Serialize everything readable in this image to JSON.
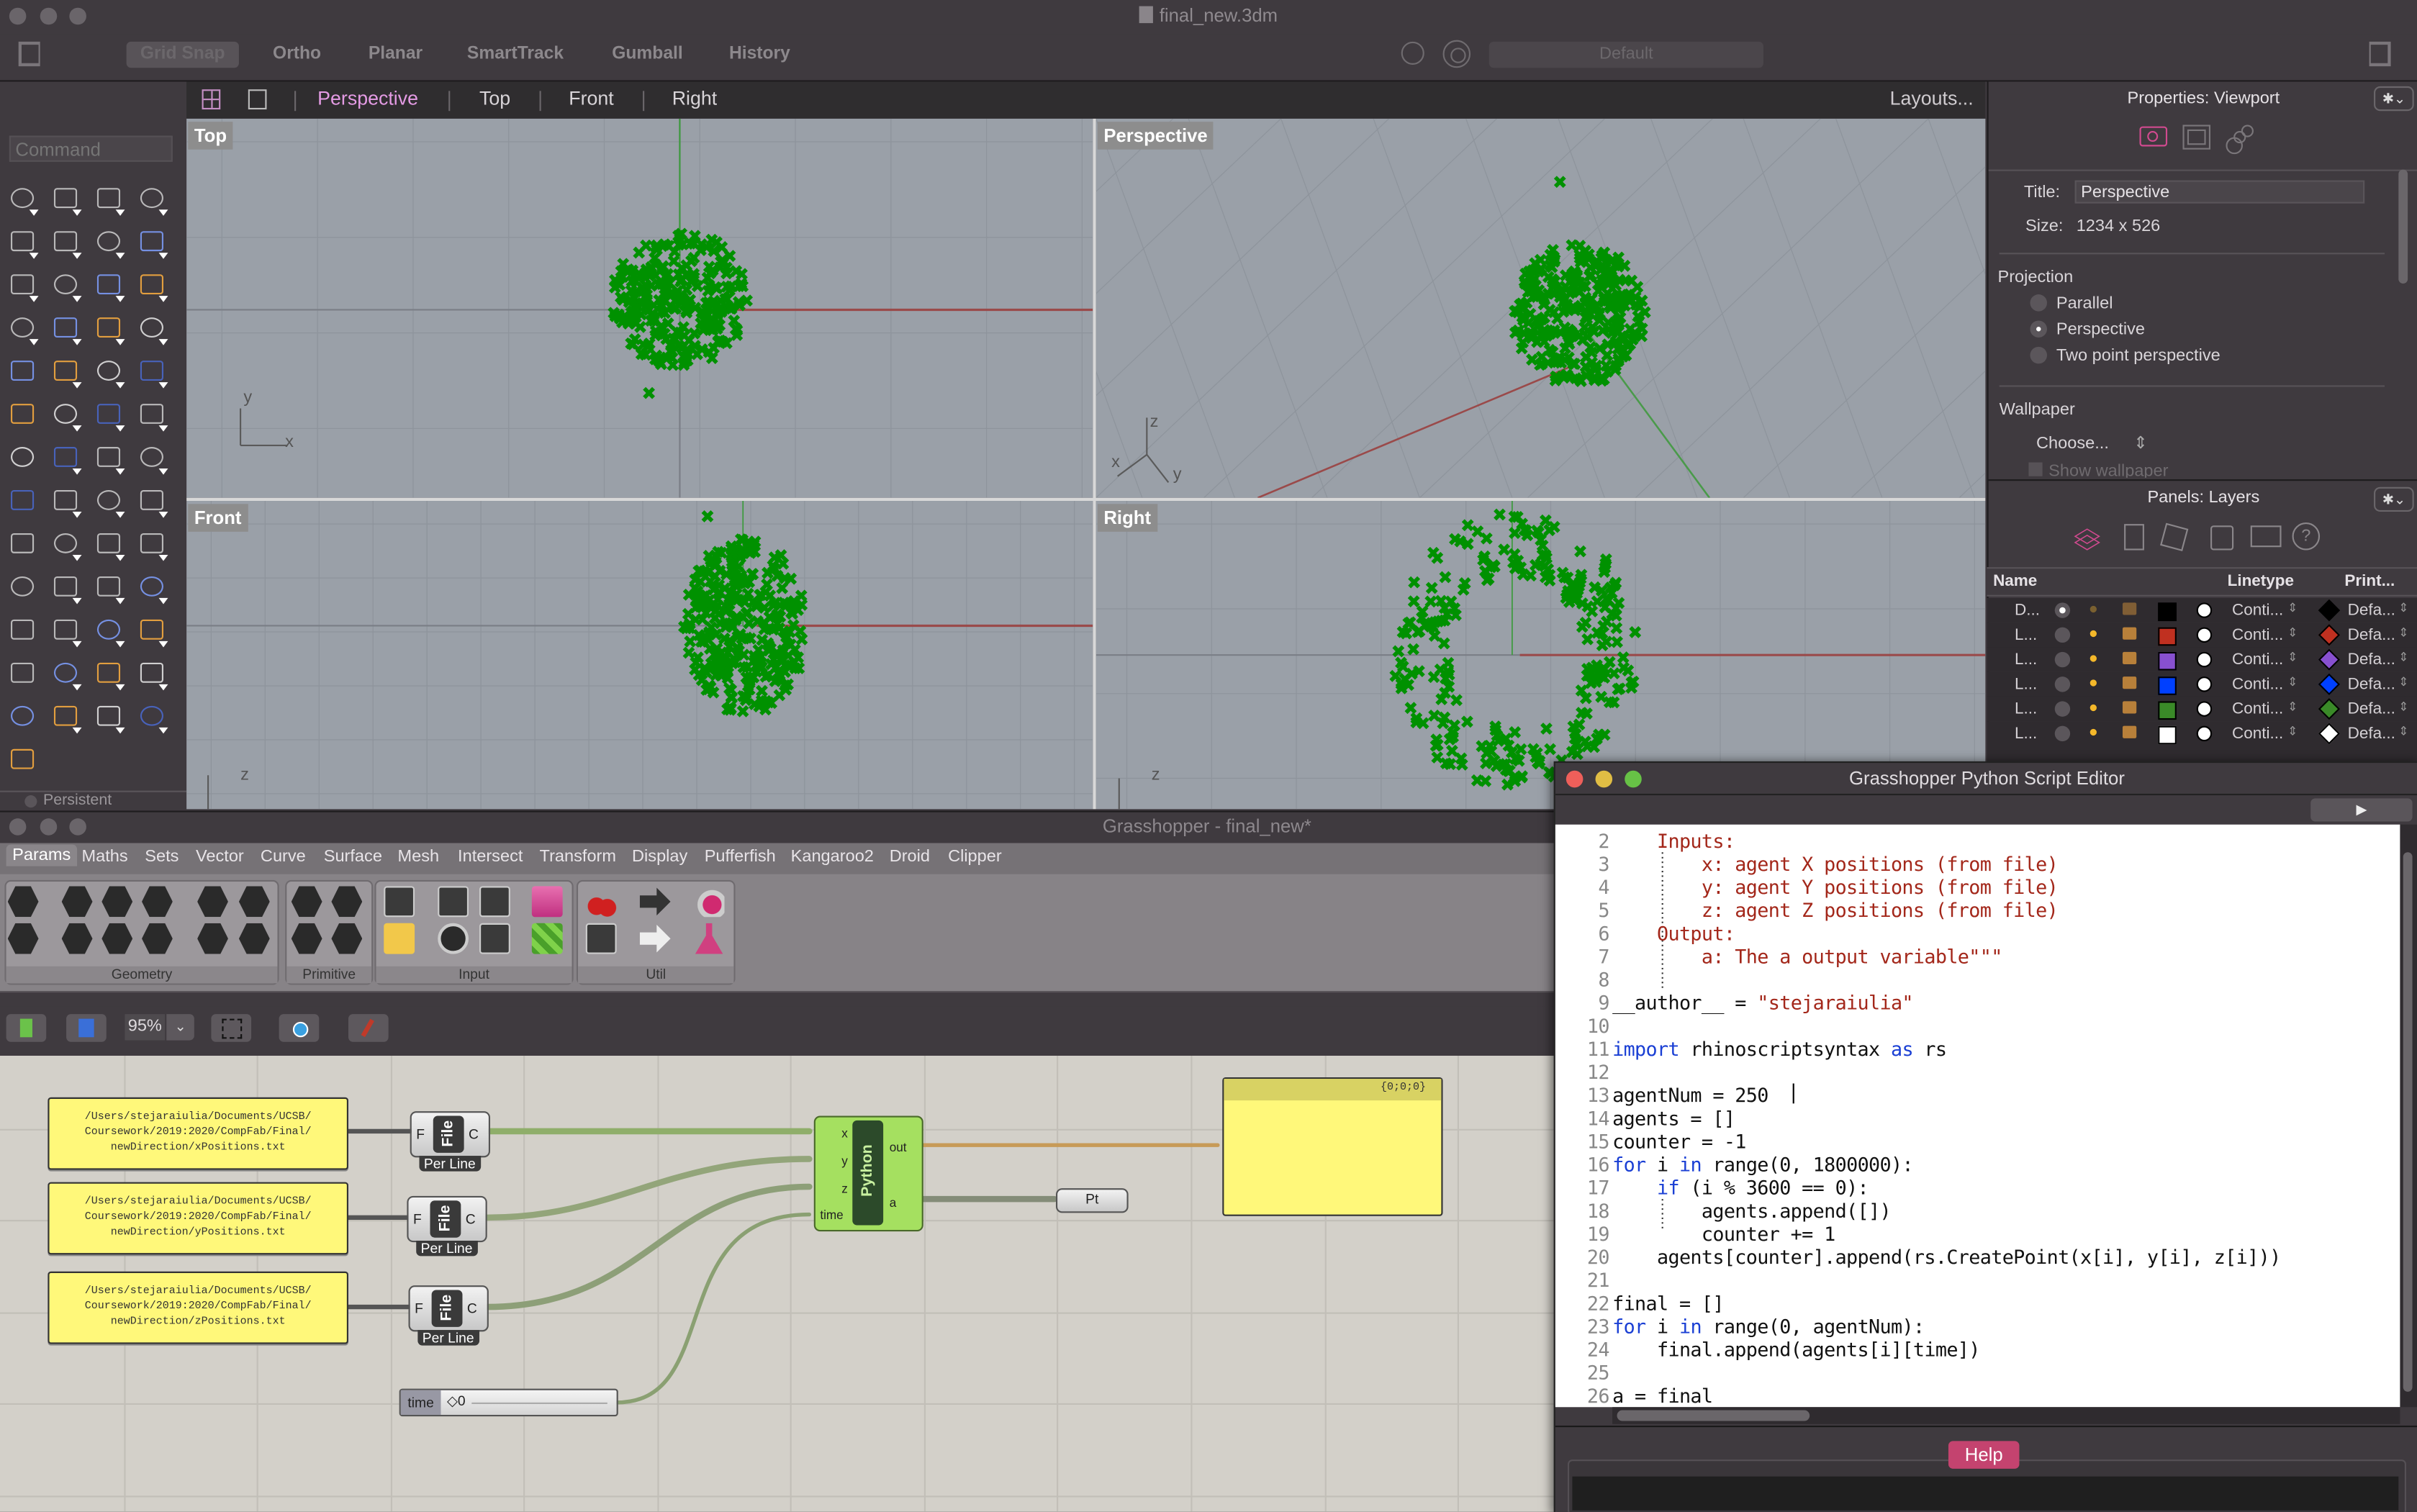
{
  "rhino": {
    "window_title": "final_new.3dm",
    "toolbar_toggles": [
      {
        "label": "Grid Snap",
        "active": true
      },
      {
        "label": "Ortho",
        "active": false
      },
      {
        "label": "Planar",
        "active": false
      },
      {
        "label": "SmartTrack",
        "active": false
      },
      {
        "label": "Gumball",
        "active": false
      },
      {
        "label": "History",
        "active": false
      }
    ],
    "display_mode": "Default",
    "viewport_tabs": [
      {
        "label": "Perspective",
        "active": true
      },
      {
        "label": "Top",
        "active": false
      },
      {
        "label": "Front",
        "active": false
      },
      {
        "label": "Right",
        "active": false
      }
    ],
    "layouts_label": "Layouts...",
    "command_placeholder": "Command",
    "persistent_label": "Persistent",
    "viewports": [
      {
        "name": "Top",
        "axes": [
          "y",
          "x"
        ]
      },
      {
        "name": "Perspective",
        "axes": [
          "z",
          "x",
          "y"
        ]
      },
      {
        "name": "Front",
        "axes": [
          "z"
        ]
      },
      {
        "name": "Right",
        "axes": [
          "z"
        ]
      }
    ],
    "point_color": "#009100",
    "tool_icons": [
      "select-arrow-icon",
      "point-icon",
      "polyline-icon",
      "curve-icon",
      "circle-icon",
      "ellipse-icon",
      "arc-icon",
      "rectangle-icon",
      "polygon-icon",
      "fillet-icon",
      "surface-from-points-icon",
      "extrude-surface-icon",
      "box-icon",
      "spheres-icon",
      "torus-icon",
      "mesh-surface-icon",
      "join-icon",
      "explode-icon",
      "trim-icon",
      "split-icon",
      "boolean-union-icon",
      "boolean-split-icon",
      "offset-curve-icon",
      "offset-dashed-icon",
      "text-icon",
      "move-icon",
      "array-icon",
      "orient-icon",
      "solid-tools-icon",
      "extrude-arrows-icon",
      "grid-array-icon",
      "distribute-icon",
      "transform-icon",
      "check-icon",
      "solids-icon",
      "pyramid-icon",
      "zoom-icon",
      "zoom-window-icon",
      "zoom-extents-icon",
      "zoom-selected-icon",
      "rotate-view-icon",
      "walkabout-icon",
      "cplane-icon",
      "named-views-icon",
      "light-icon",
      "lock-icon",
      "layers-icon",
      "color-wheel-icon",
      "render-sphere-icon",
      "render-grid-icon",
      "material-sphere-icon",
      "spotlight-icon",
      "dimension-icon"
    ]
  },
  "properties_panel": {
    "title": "Properties: Viewport",
    "title_label": "Title:",
    "title_value": "Perspective",
    "size_label": "Size:",
    "size_value": "1234 x 526",
    "projection_label": "Projection",
    "projection_options": [
      {
        "label": "Parallel",
        "selected": false
      },
      {
        "label": "Perspective",
        "selected": true
      },
      {
        "label": "Two point perspective",
        "selected": false
      }
    ],
    "wallpaper_label": "Wallpaper",
    "wallpaper_choose": "Choose...",
    "show_wallpaper_label": "Show wallpaper"
  },
  "layers_panel": {
    "title": "Panels: Layers",
    "columns": [
      "Name",
      "Linetype",
      "Print..."
    ],
    "rows": [
      {
        "name": "D...",
        "current": true,
        "light_on": false,
        "color": "#000000",
        "linetype": "Conti...",
        "print_color": "#000000",
        "print_width": "Defa..."
      },
      {
        "name": "L...",
        "current": false,
        "light_on": true,
        "color": "#c03020",
        "linetype": "Conti...",
        "print_color": "#c03020",
        "print_width": "Defa..."
      },
      {
        "name": "L...",
        "current": false,
        "light_on": true,
        "color": "#8850d0",
        "linetype": "Conti...",
        "print_color": "#8850d0",
        "print_width": "Defa..."
      },
      {
        "name": "L...",
        "current": false,
        "light_on": true,
        "color": "#0040ff",
        "linetype": "Conti...",
        "print_color": "#0040ff",
        "print_width": "Defa..."
      },
      {
        "name": "L...",
        "current": false,
        "light_on": true,
        "color": "#3a8a28",
        "linetype": "Conti...",
        "print_color": "#3a8a28",
        "print_width": "Defa..."
      },
      {
        "name": "L...",
        "current": false,
        "light_on": true,
        "color": "#ffffff",
        "linetype": "Conti...",
        "print_color": "#ffffff",
        "print_width": "Defa..."
      }
    ]
  },
  "grasshopper": {
    "window_title": "Grasshopper - final_new*",
    "tabs": [
      "Params",
      "Maths",
      "Sets",
      "Vector",
      "Curve",
      "Surface",
      "Mesh",
      "Intersect",
      "Transform",
      "Display",
      "Pufferfish",
      "Kangaroo2",
      "Droid",
      "Clipper"
    ],
    "active_tab": "Params",
    "ribbon_groups": [
      "Geometry",
      "Primitive",
      "Input",
      "Util"
    ],
    "zoom_level": "95%",
    "panels": [
      {
        "text": [
          "/Users/stejaraiulia/Documents/UCSB/",
          "Coursework/2019:2020/CompFab/Final/",
          "newDirection/xPositions.txt"
        ]
      },
      {
        "text": [
          "/Users/stejaraiulia/Documents/UCSB/",
          "Coursework/2019:2020/CompFab/Final/",
          "newDirection/yPositions.txt"
        ]
      },
      {
        "text": [
          "/Users/stejaraiulia/Documents/UCSB/",
          "Coursework/2019:2020/CompFab/Final/",
          "newDirection/zPositions.txt"
        ]
      }
    ],
    "file_component": {
      "label": "File",
      "input": "F",
      "output": "C",
      "mode": "Per Line"
    },
    "python_component": {
      "label": "Python",
      "inputs": [
        "x",
        "y",
        "z",
        "time"
      ],
      "outputs": [
        "out",
        "a"
      ]
    },
    "point_param": "Pt",
    "slider": {
      "name": "time",
      "value": "0"
    },
    "output_panel_path": "{0;0;0}"
  },
  "python_editor": {
    "title": "Grasshopper Python Script Editor",
    "run_label": "▶",
    "help_label": "Help",
    "lines": [
      {
        "n": "2",
        "parts": [
          {
            "t": "    Inputs:",
            "c": "st"
          }
        ]
      },
      {
        "n": "3",
        "parts": [
          {
            "t": "        x: agent X positions (from file)",
            "c": "st"
          }
        ]
      },
      {
        "n": "4",
        "parts": [
          {
            "t": "        y: agent Y positions (from file)",
            "c": "st"
          }
        ]
      },
      {
        "n": "5",
        "parts": [
          {
            "t": "        z: agent Z positions (from file)",
            "c": "st"
          }
        ]
      },
      {
        "n": "6",
        "parts": [
          {
            "t": "    Output:",
            "c": "st"
          }
        ]
      },
      {
        "n": "7",
        "parts": [
          {
            "t": "        a: The a output variable\"\"\"",
            "c": "st"
          }
        ]
      },
      {
        "n": "8",
        "parts": [
          {
            "t": "",
            "c": ""
          }
        ]
      },
      {
        "n": "9",
        "parts": [
          {
            "t": "__author__ = ",
            "c": ""
          },
          {
            "t": "\"stejaraiulia\"",
            "c": "st"
          }
        ]
      },
      {
        "n": "10",
        "parts": [
          {
            "t": "",
            "c": ""
          }
        ]
      },
      {
        "n": "11",
        "parts": [
          {
            "t": "import",
            "c": "kw"
          },
          {
            "t": " rhinoscriptsyntax ",
            "c": ""
          },
          {
            "t": "as",
            "c": "kw"
          },
          {
            "t": " rs",
            "c": ""
          }
        ]
      },
      {
        "n": "12",
        "parts": [
          {
            "t": "",
            "c": ""
          }
        ]
      },
      {
        "n": "13",
        "parts": [
          {
            "t": "agentNum = 250",
            "c": ""
          }
        ]
      },
      {
        "n": "14",
        "parts": [
          {
            "t": "agents = []",
            "c": ""
          }
        ]
      },
      {
        "n": "15",
        "parts": [
          {
            "t": "counter = -1",
            "c": ""
          }
        ]
      },
      {
        "n": "16",
        "parts": [
          {
            "t": "for",
            "c": "kw"
          },
          {
            "t": " i ",
            "c": ""
          },
          {
            "t": "in",
            "c": "kw"
          },
          {
            "t": " range(0, 1800000):",
            "c": ""
          }
        ]
      },
      {
        "n": "17",
        "parts": [
          {
            "t": "    ",
            "c": ""
          },
          {
            "t": "if",
            "c": "kw"
          },
          {
            "t": " (i % 3600 == 0):",
            "c": ""
          }
        ]
      },
      {
        "n": "18",
        "parts": [
          {
            "t": "        agents.append([])",
            "c": ""
          }
        ]
      },
      {
        "n": "19",
        "parts": [
          {
            "t": "        counter += 1",
            "c": ""
          }
        ]
      },
      {
        "n": "20",
        "parts": [
          {
            "t": "    agents[counter].append(rs.CreatePoint(x[i], y[i], z[i]))",
            "c": ""
          }
        ]
      },
      {
        "n": "21",
        "parts": [
          {
            "t": "",
            "c": ""
          }
        ]
      },
      {
        "n": "22",
        "parts": [
          {
            "t": "final = []",
            "c": ""
          }
        ]
      },
      {
        "n": "23",
        "parts": [
          {
            "t": "for",
            "c": "kw"
          },
          {
            "t": " i ",
            "c": ""
          },
          {
            "t": "in",
            "c": "kw"
          },
          {
            "t": " range(0, agentNum):",
            "c": ""
          }
        ]
      },
      {
        "n": "24",
        "parts": [
          {
            "t": "    final.append(agents[i][time])",
            "c": ""
          }
        ]
      },
      {
        "n": "25",
        "parts": [
          {
            "t": "",
            "c": ""
          }
        ]
      },
      {
        "n": "26",
        "parts": [
          {
            "t": "a = final",
            "c": ""
          }
        ]
      }
    ]
  }
}
